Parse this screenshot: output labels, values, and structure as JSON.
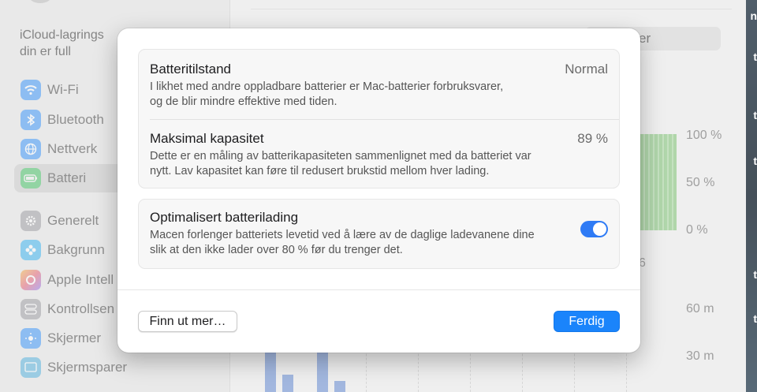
{
  "background": {
    "sidebar": {
      "storage_text_line1": "iCloud-lagrings",
      "storage_text_line2": "din er full",
      "items": [
        {
          "label": "Wi-Fi",
          "icon": "wifi-icon",
          "color": "#1a84fb"
        },
        {
          "label": "Bluetooth",
          "icon": "bluetooth-icon",
          "color": "#1a84fb"
        },
        {
          "label": "Nettverk",
          "icon": "globe-icon",
          "color": "#1a84fb"
        },
        {
          "label": "Batteri",
          "icon": "battery-icon",
          "color": "#34c759"
        },
        {
          "label": "Generelt",
          "icon": "gear-icon",
          "color": "#8e8e93"
        },
        {
          "label": "Bakgrunn",
          "icon": "flower-icon",
          "color": "#1aa8f0"
        },
        {
          "label": "Apple Intell",
          "icon": "apple-intelligence-icon",
          "color": "#e26a3a"
        },
        {
          "label": "Kontrollsen",
          "icon": "control-center-icon",
          "color": "#8e8e93"
        },
        {
          "label": "Skjermer",
          "icon": "sun-icon",
          "color": "#1a84fb"
        },
        {
          "label": "Skjermsparer",
          "icon": "screensaver-icon",
          "color": "#3aa6d8"
        }
      ]
    },
    "search_fragment": "er",
    "chart_top": {
      "labels": [
        "100 %",
        "50 %",
        "0 %"
      ],
      "x_fragment": "6"
    },
    "chart_bottom": {
      "labels": [
        "60 m",
        "30 m"
      ]
    },
    "edge_letters": [
      "n",
      "t",
      "t",
      "t",
      "t",
      "t"
    ]
  },
  "sheet": {
    "battery_health": {
      "title": "Batteritilstand",
      "value": "Normal",
      "description_line1": "I likhet med andre oppladbare batterier er Mac-batterier forbruksvarer,",
      "description_line2": "og de blir mindre effektive med tiden."
    },
    "max_capacity": {
      "title": "Maksimal kapasitet",
      "value": "89 %",
      "description_line1": "Dette er en måling av batterikapasiteten sammenlignet med da batteriet var",
      "description_line2": "nytt. Lav kapasitet kan føre til redusert brukstid mellom hver lading."
    },
    "optimized_charging": {
      "title": "Optimalisert batterilading",
      "enabled": true,
      "description_line1": "Macen forlenger batteriets levetid ved å lære av de daglige ladevanene dine",
      "description_line2": "slik at den ikke lader over 80 % før du trenger det."
    },
    "learn_more_label": "Finn ut mer…",
    "done_label": "Ferdig",
    "accent_color": "#1a84fb"
  }
}
